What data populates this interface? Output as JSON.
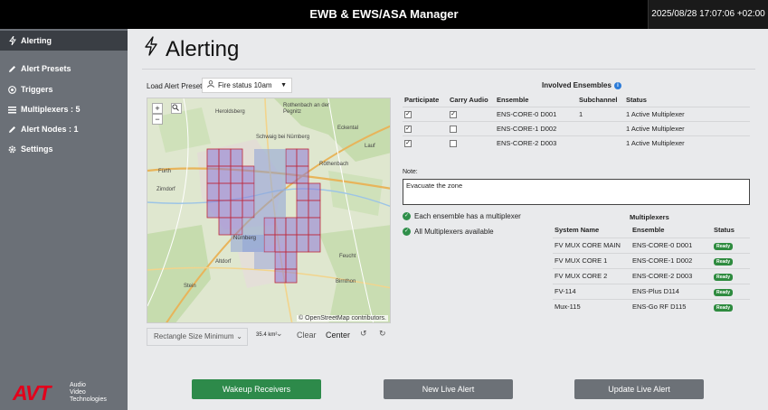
{
  "header": {
    "title": "EWB & EWS/ASA Manager",
    "datetime": "2025/08/28 17:07:06 +02:00"
  },
  "sidebar": {
    "items": [
      {
        "label": "Alerting",
        "icon": "bolt-icon"
      },
      {
        "label": "Alert Presets",
        "icon": "edit-icon"
      },
      {
        "label": "Triggers",
        "icon": "target-icon"
      },
      {
        "label": "Multiplexers : 5",
        "icon": "list-icon"
      },
      {
        "label": "Alert Nodes : 1",
        "icon": "edit-icon"
      },
      {
        "label": "Settings",
        "icon": "gear-icon"
      }
    ],
    "logo": {
      "brand": "AVT",
      "line1": "Audio",
      "line2": "Video",
      "line3": "Technologies"
    }
  },
  "page": {
    "title": "Alerting"
  },
  "preset": {
    "label": "Load Alert Preset:",
    "value": "Fire status 10am"
  },
  "map": {
    "labels": [
      "Rothenbach an der Pegnitz",
      "Schwaig bei Nürnberg",
      "Nürnberg",
      "Röthenbach",
      "Fürth",
      "Zirndorf",
      "Feucht",
      "Altdorf",
      "Stein",
      "Birnthon",
      "Heroldsberg",
      "Eckental",
      "Lauf"
    ],
    "attribution": "© OpenStreetMap contributors."
  },
  "map_tools": {
    "size_select": "Rectangle Size Minimum",
    "area": "35.4 km²",
    "clear": "Clear",
    "center": "Center"
  },
  "ensembles": {
    "heading": "Involved Ensembles",
    "columns": [
      "Participate",
      "Carry Audio",
      "Ensemble",
      "Subchannel",
      "Status"
    ],
    "rows": [
      {
        "participate": true,
        "carry_audio": true,
        "ensemble": "ENS-CORE-0 D001",
        "subchannel": "1",
        "status": "1 Active Multiplexer"
      },
      {
        "participate": true,
        "carry_audio": false,
        "ensemble": "ENS-CORE-1 D002",
        "subchannel": "",
        "status": "1 Active Multiplexer"
      },
      {
        "participate": true,
        "carry_audio": false,
        "ensemble": "ENS-CORE-2 D003",
        "subchannel": "",
        "status": "1 Active Multiplexer"
      }
    ]
  },
  "note": {
    "label": "Note:",
    "value": "Evacuate the zone"
  },
  "checks": [
    "Each ensemble has a multiplexer",
    "All Multiplexers available"
  ],
  "multiplexers": {
    "heading": "Multiplexers",
    "columns": [
      "System Name",
      "Ensemble",
      "Status"
    ],
    "rows": [
      {
        "name": "FV MUX CORE MAIN",
        "ensemble": "ENS-CORE-0 D001",
        "status": "Ready"
      },
      {
        "name": "FV MUX CORE 1",
        "ensemble": "ENS-CORE-1 D002",
        "status": "Ready"
      },
      {
        "name": "FV MUX CORE 2",
        "ensemble": "ENS-CORE-2 D003",
        "status": "Ready"
      },
      {
        "name": "FV-114",
        "ensemble": "ENS-Plus D114",
        "status": "Ready"
      },
      {
        "name": "Mux-115",
        "ensemble": "ENS-Go RF D115",
        "status": "Ready"
      }
    ]
  },
  "buttons": {
    "wakeup": "Wakeup Receivers",
    "new_alert": "New Live Alert",
    "update_alert": "Update Live Alert"
  },
  "colors": {
    "accent_green": "#2d8a4a",
    "grid_red": "#c0283a",
    "sidebar": "#6b7077"
  }
}
